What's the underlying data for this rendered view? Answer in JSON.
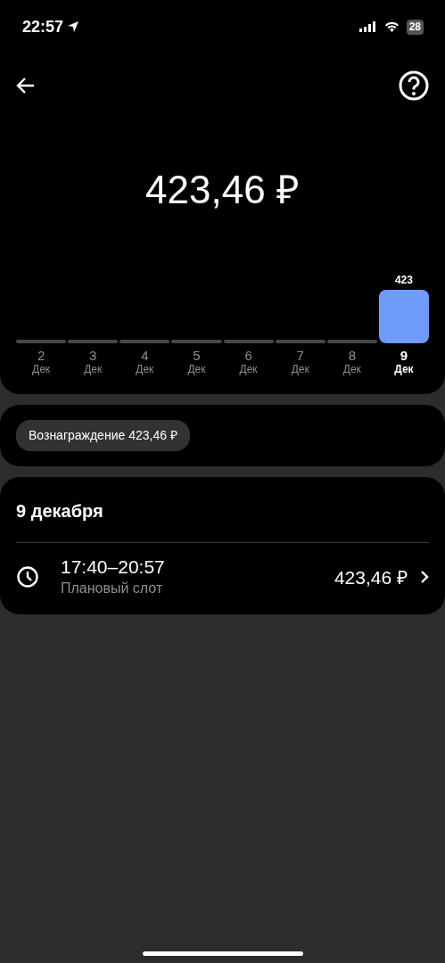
{
  "status_bar": {
    "time": "22:57",
    "battery": "28"
  },
  "header": {
    "total": "423,46 ₽"
  },
  "days": [
    {
      "day": "2",
      "month": "Дек",
      "selected": false
    },
    {
      "day": "3",
      "month": "Дек",
      "selected": false
    },
    {
      "day": "4",
      "month": "Дек",
      "selected": false
    },
    {
      "day": "5",
      "month": "Дек",
      "selected": false
    },
    {
      "day": "6",
      "month": "Дек",
      "selected": false
    },
    {
      "day": "7",
      "month": "Дек",
      "selected": false
    },
    {
      "day": "8",
      "month": "Дек",
      "selected": false
    },
    {
      "day": "9",
      "month": "Дек",
      "selected": true,
      "value": "423"
    }
  ],
  "reward_chip": "Вознаграждение 423,46 ₽",
  "date_section": {
    "title": "9 декабря",
    "slots": [
      {
        "time": "17:40–20:57",
        "label": "Плановый слот",
        "amount": "423,46 ₽"
      }
    ]
  }
}
